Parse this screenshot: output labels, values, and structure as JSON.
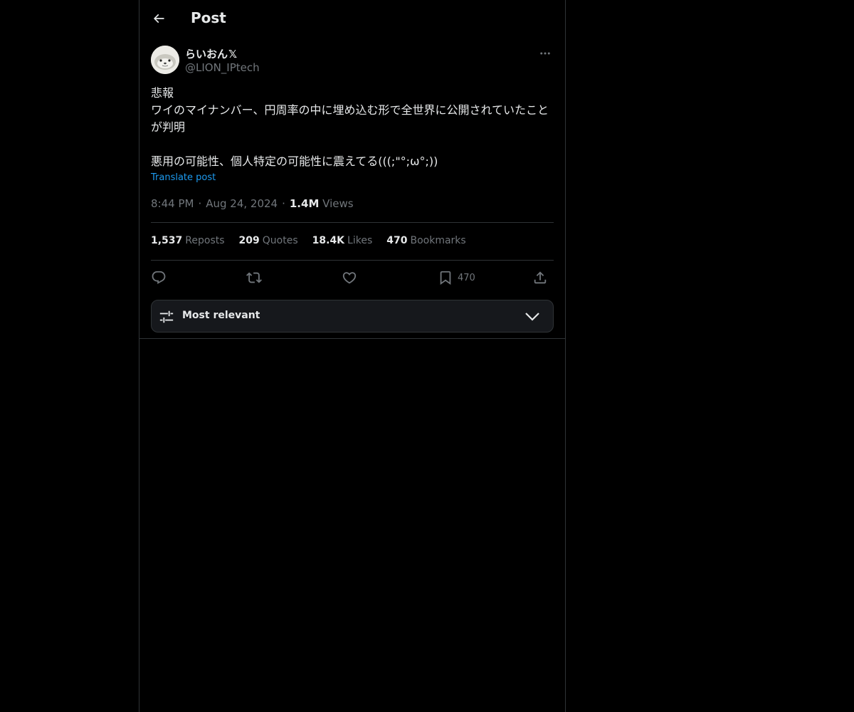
{
  "header": {
    "title": "Post"
  },
  "author": {
    "display_name": "らいおん",
    "badge": "𝕏",
    "handle": "@LION_IPtech",
    "avatar_icon": "avatar-seal-icon"
  },
  "post": {
    "text": "悲報\nワイのマイナンバー、円周率の中に埋め込む形で全世界に公開されていたことが判明\n\n悪用の可能性、個人特定の可能性に震えてる(((;\"°;ω°;))",
    "translate_label": "Translate post",
    "time": "8:44 PM",
    "date": "Aug 24, 2024",
    "views_count": "1.4M",
    "views_label": "Views",
    "separator": "·"
  },
  "stats": {
    "reposts_count": "1,537",
    "reposts_label": "Reposts",
    "quotes_count": "209",
    "quotes_label": "Quotes",
    "likes_count": "18.4K",
    "likes_label": "Likes",
    "bookmarks_count": "470",
    "bookmarks_label": "Bookmarks"
  },
  "actions": {
    "reply_icon": "reply-icon",
    "repost_icon": "repost-icon",
    "like_icon": "heart-icon",
    "bookmark_icon": "bookmark-icon",
    "bookmark_count": "470",
    "share_icon": "share-icon"
  },
  "sort": {
    "label": "Most relevant"
  },
  "colors": {
    "background": "#000000",
    "text_primary": "#e7e9ea",
    "text_secondary": "#71767b",
    "link": "#1d9bf0",
    "border": "#2f3336",
    "sort_bg": "#16181c"
  }
}
